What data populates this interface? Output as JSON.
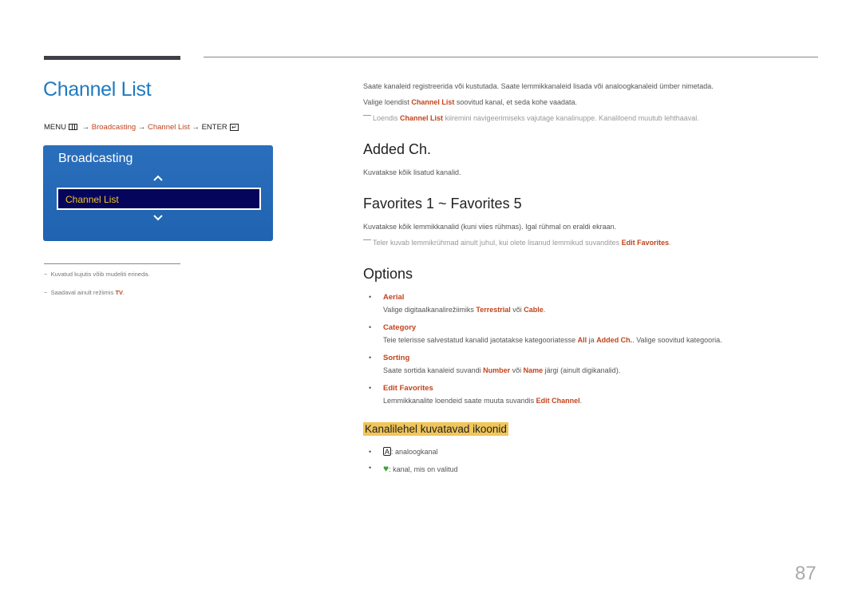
{
  "header": {
    "title": "Channel List"
  },
  "menu_path": {
    "menu": "MENU",
    "arrow": "→",
    "step1": "Broadcasting",
    "step2": "Channel List",
    "enter": "ENTER",
    "menu_icon": "menu-grid-icon",
    "enter_icon": "enter-icon"
  },
  "osd": {
    "title": "Broadcasting",
    "selected_item": "Channel List",
    "up_icon": "chevron-up-icon",
    "down_icon": "chevron-down-icon"
  },
  "footnotes": [
    {
      "dash": "−",
      "text": "Kuvatud kujutis võib mudeliti erineda."
    },
    {
      "dash": "−",
      "text_before": "Saadaval ainult režiimis ",
      "highlight": "TV",
      "text_after": "."
    }
  ],
  "intro": {
    "line1": "Saate kanaleid registreerida või kustutada. Saate lemmikkanaleid lisada või analoogkanaleid ümber nimetada.",
    "line2_before": "Valige loendist ",
    "line2_hl": "Channel List",
    "line2_after": " soovitud kanal, et seda kohe vaadata.",
    "note_before": "Loendis ",
    "note_hl": "Channel List",
    "note_after": " kiiremini navigeerimiseks vajutage kanalinuppe. Kanaliloend muutub lehthaaval."
  },
  "sections": {
    "added": {
      "title": "Added Ch.",
      "desc": "Kuvatakse kõik lisatud kanalid."
    },
    "favorites": {
      "title": "Favorites 1 ~ Favorites 5",
      "desc": "Kuvatakse kõik lemmikkanalid (kuni viies rühmas). Igal rühmal on eraldi ekraan.",
      "note_before": "Teler kuvab lemmikrühmad ainult juhul, kui olete lisanud lemmikud suvandites ",
      "note_hl": "Edit Favorites",
      "note_after": "."
    },
    "options": {
      "title": "Options",
      "bullet": "•",
      "items": [
        {
          "title": "Aerial",
          "d1": "Valige digitaalkanalirežiimiks ",
          "h1": "Terrestrial",
          "d2": " või ",
          "h2": "Cable",
          "d3": "."
        },
        {
          "title": "Category",
          "d1": "Teie telerisse salvestatud kanalid jaotatakse kategooriatesse ",
          "h1": "All",
          "d2": " ja ",
          "h2": "Added Ch.",
          "d3": ". Valige soovitud kategooria."
        },
        {
          "title": "Sorting",
          "d1": "Saate sortida kanaleid suvandi ",
          "h1": "Number",
          "d2": " või ",
          "h2": "Name",
          "d3": " järgi (ainult digikanalid)."
        },
        {
          "title": "Edit Favorites",
          "d1": "Lemmikkanalite loendeid saate muuta suvandis ",
          "h1": "Edit Channel",
          "d2": ".",
          "h2": "",
          "d3": ""
        }
      ]
    },
    "icons": {
      "title": "Kanalilehel kuvatavad ikoonid",
      "items": [
        {
          "icon": "analog-a-icon",
          "glyph": "A",
          "text": ": analoogkanal"
        },
        {
          "icon": "heart-icon",
          "glyph": "♥",
          "text": ": kanal, mis on valitud"
        }
      ]
    }
  },
  "colors": {
    "title_blue": "#1e7bc1",
    "highlight_orange": "#c1441c",
    "osd_blue": "#1f63b1",
    "osd_selected_bg": "#05055c",
    "osd_selected_text": "#f3c425",
    "heading_highlight": "#f0c65b",
    "heart_green": "#3aa335"
  },
  "page_number": "87"
}
